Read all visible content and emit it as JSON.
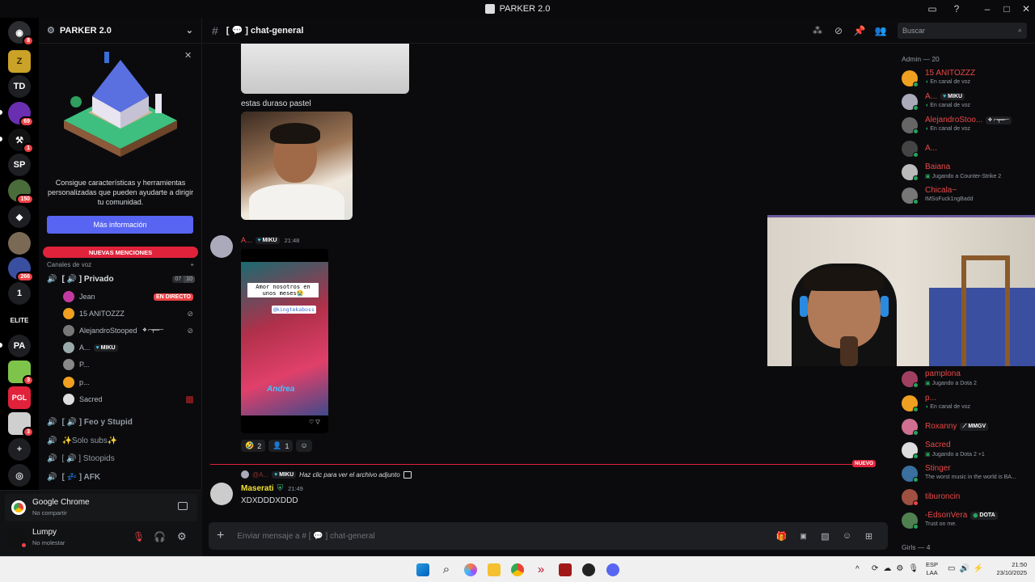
{
  "window": {
    "title": "PARKER 2.0"
  },
  "header": {
    "channel_name": "[ 💬 ] chat-general",
    "search_placeholder": "Buscar"
  },
  "server": {
    "name": "PARKER 2.0"
  },
  "rail": {
    "badges": {
      "discord": "8",
      "vc": "69",
      "hammer": "1",
      "srv150": "150",
      "srv266": "266",
      "one": "1",
      "g3": "3",
      "ab3": "3"
    },
    "labels": {
      "td": "TD",
      "sp": "SP",
      "one": "1",
      "pa": "PA",
      "elite": "ELITE",
      "pgl": "PGL"
    }
  },
  "promo": {
    "text": "Consigue características y herramientas personalizadas que pueden ayudarte a dirigir tu comunidad.",
    "button": "Más información"
  },
  "sidebar": {
    "mentions_banner": "NUEVAS MENCIONES",
    "voice_section": "Canales de voz",
    "privado": {
      "name": "[ 🔊 ] Privado",
      "count_a": "07",
      "count_b": "10"
    },
    "voice_users": [
      {
        "name": "Jean",
        "tag": "EN DIRECTO"
      },
      {
        "name": "15 ANITOZZZ"
      },
      {
        "name": "AlejandroStooped",
        "tag": "⟡ ⌐╤═─"
      },
      {
        "name": "A...",
        "tag": "MIKU"
      },
      {
        "name": "P..."
      },
      {
        "name": "p..."
      },
      {
        "name": "Sacred"
      }
    ],
    "channels": [
      "[ 🔊 ] Feo y Stupid",
      "✨Solo subs✨",
      "[ 🔊 ] Stoopids",
      "[ 💤 ] AFK"
    ]
  },
  "stream_panel": {
    "app": "Google Chrome",
    "status": "No compartir"
  },
  "user": {
    "name": "Lumpy",
    "status": "No molestar"
  },
  "chat": {
    "msg1_text": "estas duraso pastel",
    "msg2": {
      "author": "A...",
      "tag": "MIKU",
      "time": "21:48",
      "story_text1": "Amor nosotros en unos meses😭",
      "story_text2": "@kingtekaboss",
      "story_name": "Andrea"
    },
    "reactions": [
      {
        "emoji": "🤣",
        "count": "2"
      },
      {
        "emoji": "👤",
        "count": "1"
      }
    ],
    "new_label": "NUEVO",
    "reply": {
      "author": "@A...",
      "tag": "MIKU",
      "text": "Haz clic para ver el archivo adjunto"
    },
    "msg3": {
      "author": "Maserati",
      "time": "21:49",
      "text": "XDXDDDXDDD"
    },
    "input_placeholder": "Enviar mensaje a # [ 💬 ] chat-general"
  },
  "members": {
    "admin_header": "Admin — 20",
    "girls_header": "Girls — 4",
    "list_top": [
      {
        "name": "15 ANITOZZZ",
        "sub": "En canal de voz"
      },
      {
        "name": "A...",
        "tag": "MIKU",
        "sub": "En canal de voz"
      },
      {
        "name": "AlejandroStoo...",
        "tag": "⟡ ⌐╤═─",
        "sub": "En canal de voz"
      },
      {
        "name": "A...",
        "sub": ""
      },
      {
        "name": "Baiana",
        "sub": "Jugando a Counter-Strike 2"
      },
      {
        "name": "Chicala~",
        "sub": "IMSoFuck1ngBadd"
      }
    ],
    "list_bottom": [
      {
        "name": "pamplona",
        "sub": "Jugando a Dota 2"
      },
      {
        "name": "p...",
        "sub": "En canal de voz"
      },
      {
        "name": "Roxanny",
        "tag": "MMGV",
        "sub": ""
      },
      {
        "name": "Sacred",
        "sub": "Jugando a Dota 2 +1"
      },
      {
        "name": "Stinger",
        "sub": "The worst music in the world is BA..."
      },
      {
        "name": "tiburoncin",
        "sub": ""
      },
      {
        "name": "-EdsonVera",
        "tag": "DOTA",
        "sub": "Trust on me."
      }
    ]
  },
  "taskbar": {
    "lang": "ESP",
    "layout": "LAA",
    "time": "21:50",
    "date": "23/10/2025"
  }
}
